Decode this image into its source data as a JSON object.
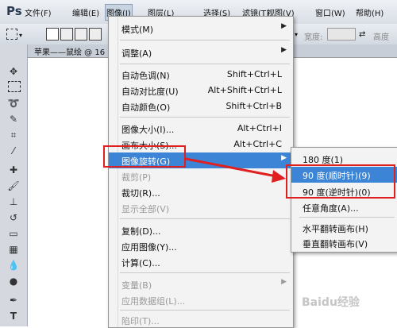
{
  "app": {
    "logo": "Ps"
  },
  "menubar": {
    "items": [
      {
        "label": "文件(F)"
      },
      {
        "label": "编辑(E)"
      },
      {
        "label": "图像(I)"
      },
      {
        "label": "图层(L)"
      },
      {
        "label": "选择(S)"
      },
      {
        "label": "滤镜(T)"
      },
      {
        "label": "视图(V)"
      },
      {
        "label": "窗口(W)"
      },
      {
        "label": "帮助(H)"
      }
    ]
  },
  "options_bar": {
    "width_label": "宽度:",
    "height_label": "高度"
  },
  "document": {
    "tab_title": "苹果——鼠绘 @ 16"
  },
  "image_menu": {
    "items": [
      {
        "label": "模式(M)",
        "shortcut": "",
        "submenu": true
      },
      {
        "label": "调整(A)",
        "shortcut": "",
        "submenu": true
      },
      {
        "label": "自动色调(N)",
        "shortcut": "Shift+Ctrl+L"
      },
      {
        "label": "自动对比度(U)",
        "shortcut": "Alt+Shift+Ctrl+L"
      },
      {
        "label": "自动颜色(O)",
        "shortcut": "Shift+Ctrl+B"
      },
      {
        "label": "图像大小(I)...",
        "shortcut": "Alt+Ctrl+I"
      },
      {
        "label": "画布大小(S)...",
        "shortcut": "Alt+Ctrl+C"
      },
      {
        "label": "图像旋转(G)",
        "shortcut": "",
        "submenu": true
      },
      {
        "label": "裁剪(P)",
        "shortcut": ""
      },
      {
        "label": "裁切(R)...",
        "shortcut": ""
      },
      {
        "label": "显示全部(V)",
        "shortcut": ""
      },
      {
        "label": "复制(D)...",
        "shortcut": ""
      },
      {
        "label": "应用图像(Y)...",
        "shortcut": ""
      },
      {
        "label": "计算(C)...",
        "shortcut": ""
      },
      {
        "label": "变量(B)",
        "shortcut": "",
        "submenu": true
      },
      {
        "label": "应用数据组(L)...",
        "shortcut": ""
      },
      {
        "label": "陷印(T)...",
        "shortcut": ""
      }
    ]
  },
  "rotate_submenu": {
    "items": [
      {
        "label": "180 度(1)"
      },
      {
        "label": "90 度(顺时针)(9)"
      },
      {
        "label": "90 度(逆时针)(0)"
      },
      {
        "label": "任意角度(A)..."
      },
      {
        "label": "水平翻转画布(H)"
      },
      {
        "label": "垂直翻转画布(V)"
      }
    ]
  },
  "colors": {
    "highlight": "#3c85d6",
    "annotation_red": "#e02020"
  },
  "watermark": {
    "text": "Baidu经验"
  }
}
